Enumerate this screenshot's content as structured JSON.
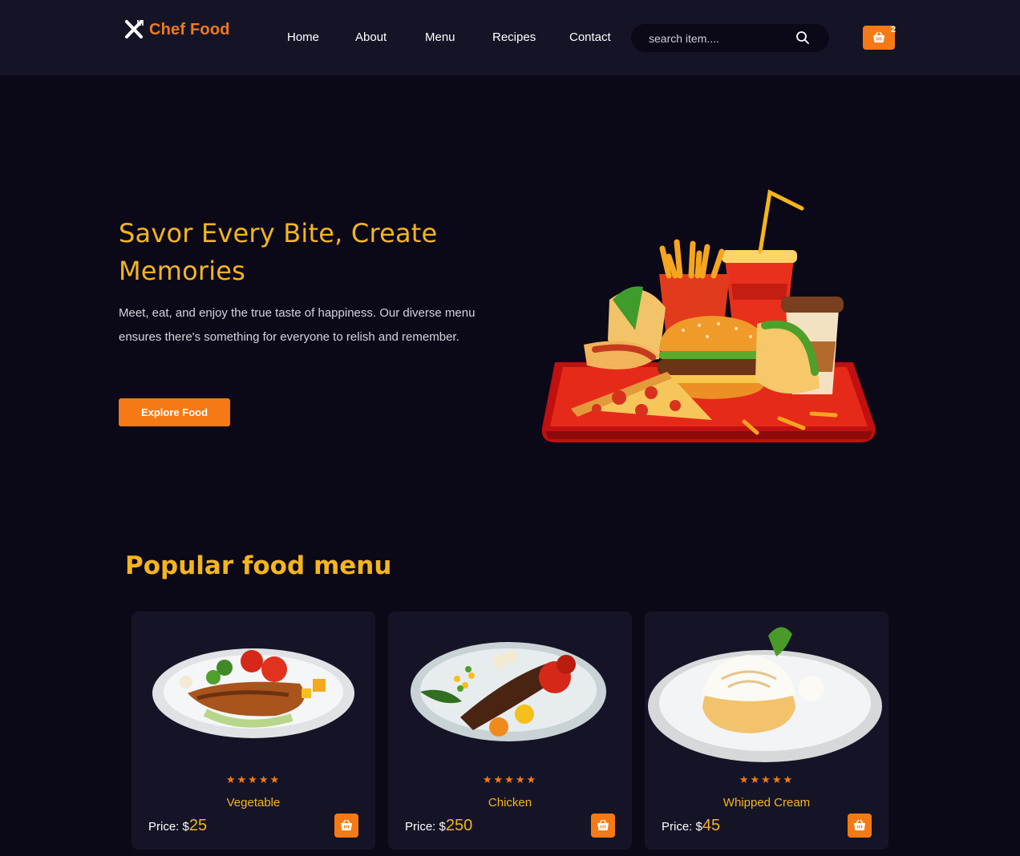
{
  "brand": {
    "name": "Chef Food",
    "accent": "#f07a1c",
    "icon": "utensils-icon"
  },
  "nav": {
    "items": [
      {
        "label": "Home"
      },
      {
        "label": "About"
      },
      {
        "label": "Menu"
      },
      {
        "label": "Recipes"
      },
      {
        "label": "Contact"
      }
    ]
  },
  "search": {
    "placeholder": "search item....",
    "icon": "search-icon"
  },
  "cart": {
    "count": "2",
    "icon": "basket-icon"
  },
  "hero": {
    "title": "Savor Every Bite, Create Memories",
    "description": "Meet, eat, and enjoy the true taste of happiness. Our diverse menu ensures there's something for everyone to relish and remember.",
    "button": "Explore Food",
    "image": "fast-food-tray-illustration"
  },
  "popular": {
    "title": "Popular food menu",
    "items": [
      {
        "name": "Vegetable",
        "price_label": "Price: $",
        "price": "25",
        "stars": "★★★★★",
        "rating": 5
      },
      {
        "name": "Chicken",
        "price_label": "Price: $",
        "price": "250",
        "stars": "★★★★★",
        "rating": 5
      },
      {
        "name": "Whipped Cream",
        "price_label": "Price: $",
        "price": "45",
        "stars": "★★★★★",
        "rating": 5
      }
    ]
  },
  "colors": {
    "background": "#0b0918",
    "surface": "#151427",
    "primary": "#f57a15",
    "heading": "#f5b51b"
  }
}
